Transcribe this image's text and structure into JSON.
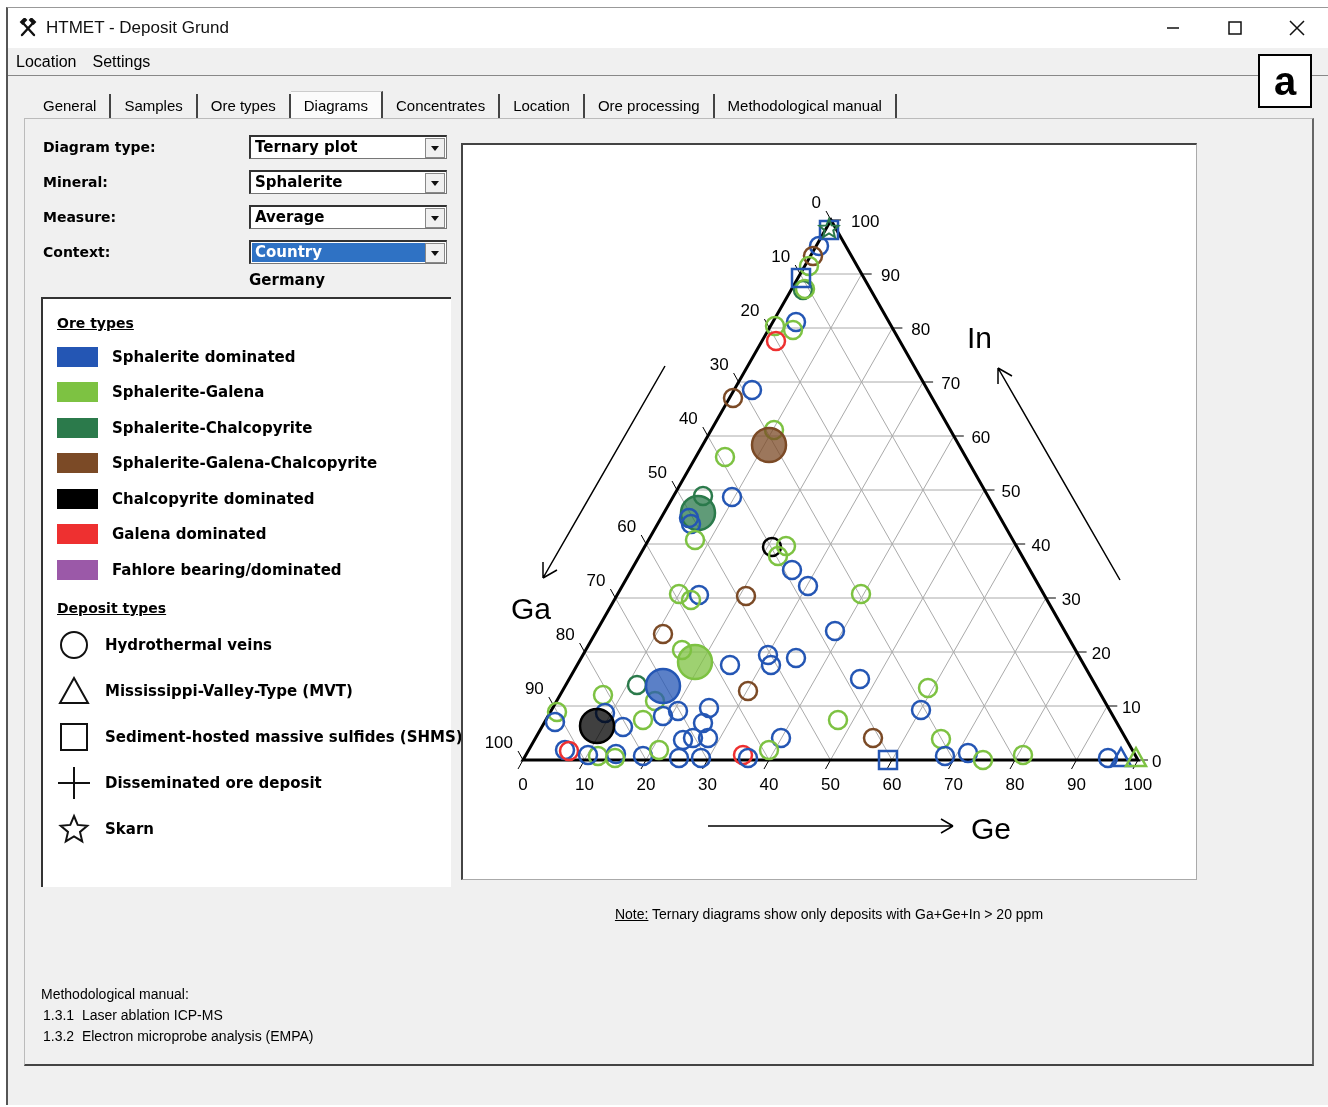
{
  "window": {
    "title": "HTMET - Deposit Grund"
  },
  "menu": [
    "Location",
    "Settings"
  ],
  "figure_label": "a",
  "tabs": [
    {
      "label": "General",
      "selected": false
    },
    {
      "label": "Samples",
      "selected": false
    },
    {
      "label": "Ore types",
      "selected": false
    },
    {
      "label": "Diagrams",
      "selected": true
    },
    {
      "label": "Concentrates",
      "selected": false
    },
    {
      "label": "Location",
      "selected": false
    },
    {
      "label": "Ore processing",
      "selected": false
    },
    {
      "label": "Methodological manual",
      "selected": false
    }
  ],
  "form": [
    {
      "label": "Diagram type:",
      "value": "Ternary plot",
      "highlighted": false
    },
    {
      "label": "Mineral:",
      "value": "Sphalerite",
      "highlighted": false
    },
    {
      "label": "Measure:",
      "value": "Average",
      "highlighted": false
    },
    {
      "label": "Context:",
      "value": "Country",
      "highlighted": true
    }
  ],
  "context_value": "Germany",
  "legend": {
    "ore_types_title": "Ore types",
    "ore_types": [
      {
        "label": "Sphalerite dominated",
        "color": "#2456b4"
      },
      {
        "label": "Sphalerite-Galena",
        "color": "#7dc242"
      },
      {
        "label": "Sphalerite-Chalcopyrite",
        "color": "#2b7a4b"
      },
      {
        "label": "Sphalerite-Galena-Chalcopyrite",
        "color": "#7b4a26"
      },
      {
        "label": "Chalcopyrite dominated",
        "color": "#000000"
      },
      {
        "label": "Galena dominated",
        "color": "#ee3030"
      },
      {
        "label": "Fahlore bearing/dominated",
        "color": "#9b59a8"
      }
    ],
    "deposit_types_title": "Deposit types",
    "deposit_types": [
      {
        "label": "Hydrothermal veins",
        "kind": "circle"
      },
      {
        "label": "Mississippi-Valley-Type (MVT)",
        "kind": "triangle"
      },
      {
        "label": "Sediment-hosted massive sulfides (SHMS)",
        "kind": "square"
      },
      {
        "label": "Disseminated ore deposit",
        "kind": "plus"
      },
      {
        "label": "Skarn",
        "kind": "star"
      }
    ]
  },
  "diagram": {
    "bottom_ticks": [
      "0",
      "10",
      "20",
      "30",
      "40",
      "50",
      "60",
      "70",
      "80",
      "90",
      "100"
    ],
    "right_ticks": [
      "0",
      "10",
      "20",
      "30",
      "40",
      "50",
      "60",
      "70",
      "80",
      "90",
      "100"
    ],
    "left_ticks": [
      "0",
      "10",
      "20",
      "30",
      "40",
      "50",
      "60",
      "70",
      "80",
      "90",
      "100"
    ],
    "left_axis": "Ga",
    "right_axis": "In",
    "bottom_axis": "Ge"
  },
  "note": {
    "label": "Note:",
    "text": "Ternary diagrams show only deposits with Ga+Ge+In > 20 ppm"
  },
  "manual": {
    "title": "Methodological manual:",
    "items": [
      "1.3.1  Laser ablation ICP-MS",
      "1.3.2  Electron microprobe analysis (EMPA)"
    ]
  }
}
